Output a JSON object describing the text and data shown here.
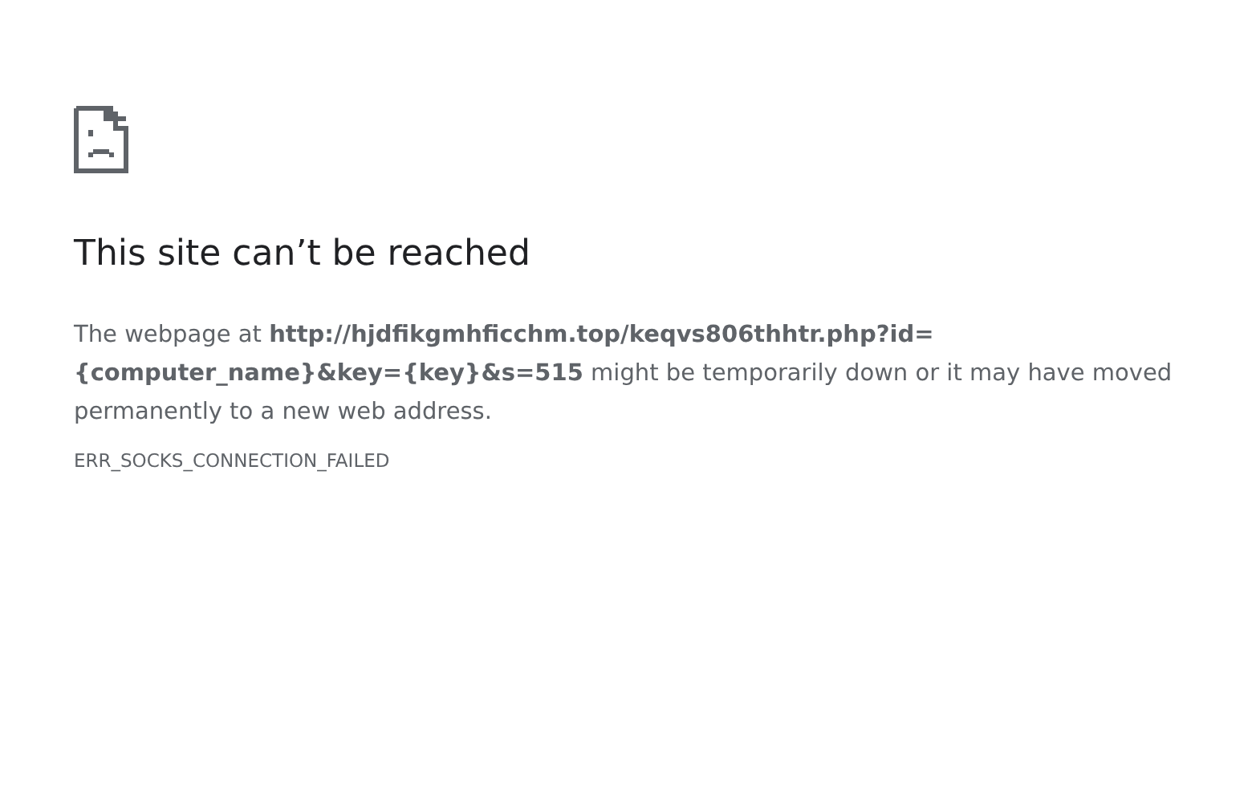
{
  "heading": "This site can’t be reached",
  "message": "The webpage at **http://hjdfikgmhficchm.top/keqvs806thhtr.php?id={computer_name}&key={key}&s=515** might be temporarily down or it may have moved permanently to a new web address.",
  "error_code": "ERR_SOCKS_CONNECTION_FAILED"
}
